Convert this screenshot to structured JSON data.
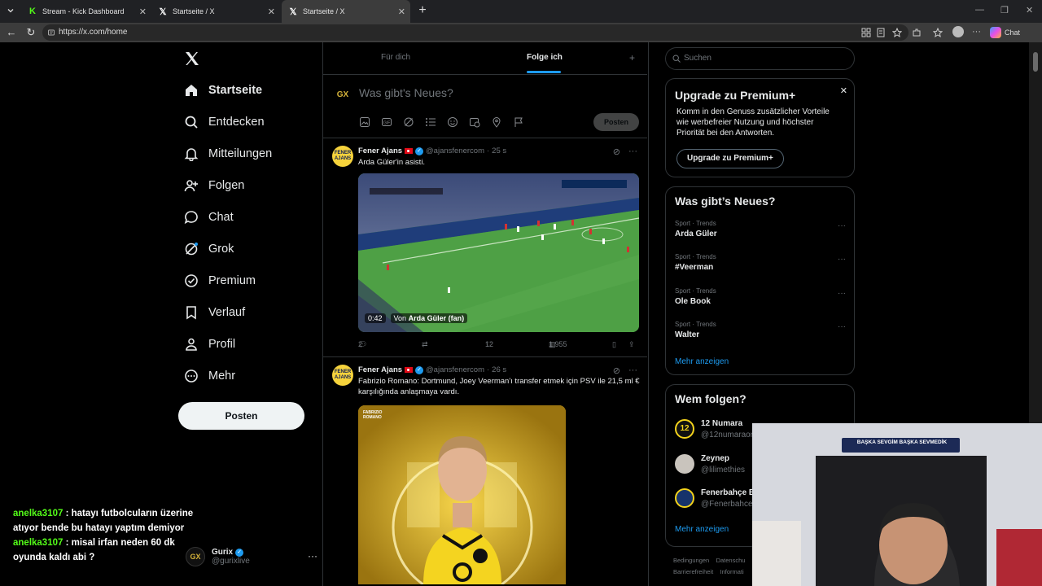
{
  "browser": {
    "tabs": [
      {
        "title": "Stream - Kick Dashboard",
        "favicon": "kick-icon"
      },
      {
        "title": "Startseite / X",
        "favicon": "x-icon"
      },
      {
        "title": "Startseite / X",
        "favicon": "x-icon"
      }
    ],
    "url": "https://x.com/home",
    "chat_label": "Chat"
  },
  "nav": {
    "items": [
      {
        "label": "Startseite",
        "icon": "home-icon"
      },
      {
        "label": "Entdecken",
        "icon": "search-icon"
      },
      {
        "label": "Mitteilungen",
        "icon": "bell-icon"
      },
      {
        "label": "Folgen",
        "icon": "person-add-icon"
      },
      {
        "label": "Chat",
        "icon": "chat-icon"
      },
      {
        "label": "Grok",
        "icon": "grok-icon"
      },
      {
        "label": "Premium",
        "icon": "premium-icon"
      },
      {
        "label": "Verlauf",
        "icon": "bookmark-icon"
      },
      {
        "label": "Profil",
        "icon": "profile-icon"
      },
      {
        "label": "Mehr",
        "icon": "more-circle-icon"
      }
    ],
    "post_label": "Posten",
    "account": {
      "name": "Gurix",
      "handle": "@gurixlive"
    }
  },
  "feed": {
    "tabs": [
      {
        "label": "Für dich"
      },
      {
        "label": "Folge ich"
      }
    ],
    "active_tab": "Folge ich",
    "compose_placeholder": "Was gibt's Neues?",
    "compose_post_label": "Posten",
    "tweets": [
      {
        "name": "Fener Ajans",
        "handle": "@ajansfenercom",
        "time": "25 s",
        "text": "Arda Güler'in asisti.",
        "media": {
          "duration": "0:42",
          "from_prefix": "Von",
          "from": "Arda Güler (fan)"
        },
        "replies": "2",
        "reposts": "",
        "likes": "12",
        "views": "1.955"
      },
      {
        "name": "Fener Ajans",
        "handle": "@ajansfenercom",
        "time": "26 s",
        "text": "Fabrizio Romano: Dortmund, Joey Veerman'ı transfer etmek için PSV ile 21,5 ml € karşılığında anlaşmaya vardı.",
        "media_caption": "FABRIZIO ROMANO"
      }
    ]
  },
  "sidebar": {
    "search_placeholder": "Suchen",
    "premium": {
      "title": "Upgrade zu Premium+",
      "text": "Komm in den Genuss zusätzlicher Vorteile wie werbefreier Nutzung und höchster Priorität bei den Antworten.",
      "button": "Upgrade zu Premium+"
    },
    "trends_title": "Was gibt’s Neues?",
    "trends": [
      {
        "category": "Sport · Trends",
        "title": "Arda Güler"
      },
      {
        "category": "Sport · Trends",
        "title": "#Veerman"
      },
      {
        "category": "Sport · Trends",
        "title": "Ole Book"
      },
      {
        "category": "Sport · Trends",
        "title": "Walter"
      }
    ],
    "show_more": "Mehr anzeigen",
    "follow_title": "Wem folgen?",
    "follow": [
      {
        "name": "12 Numara",
        "handle": "@12numaraor"
      },
      {
        "name": "Zeynep",
        "handle": "@lilimethies"
      },
      {
        "name": "Fenerbahçe E",
        "handle": "@Fenerbahce"
      }
    ],
    "footer": [
      "Bedingungen",
      "Datenschu",
      "Barrierefreiheit",
      "Informati"
    ]
  },
  "stream_chat": [
    {
      "user": "anelka3107",
      "message": "hatayı futbolcuların üzerine atıyor bende bu hatayı yaptım demiyor"
    },
    {
      "user": "anelka3107",
      "message": "misal irfan neden 60 dk oyunda kaldı abi ?"
    }
  ],
  "webcam": {
    "banner": "BAŞKA SEVGİM BAŞKA SEVMEDİK"
  },
  "colors": {
    "accent": "#1d9bf0",
    "kick_green": "#53fc18",
    "background": "#000000"
  }
}
